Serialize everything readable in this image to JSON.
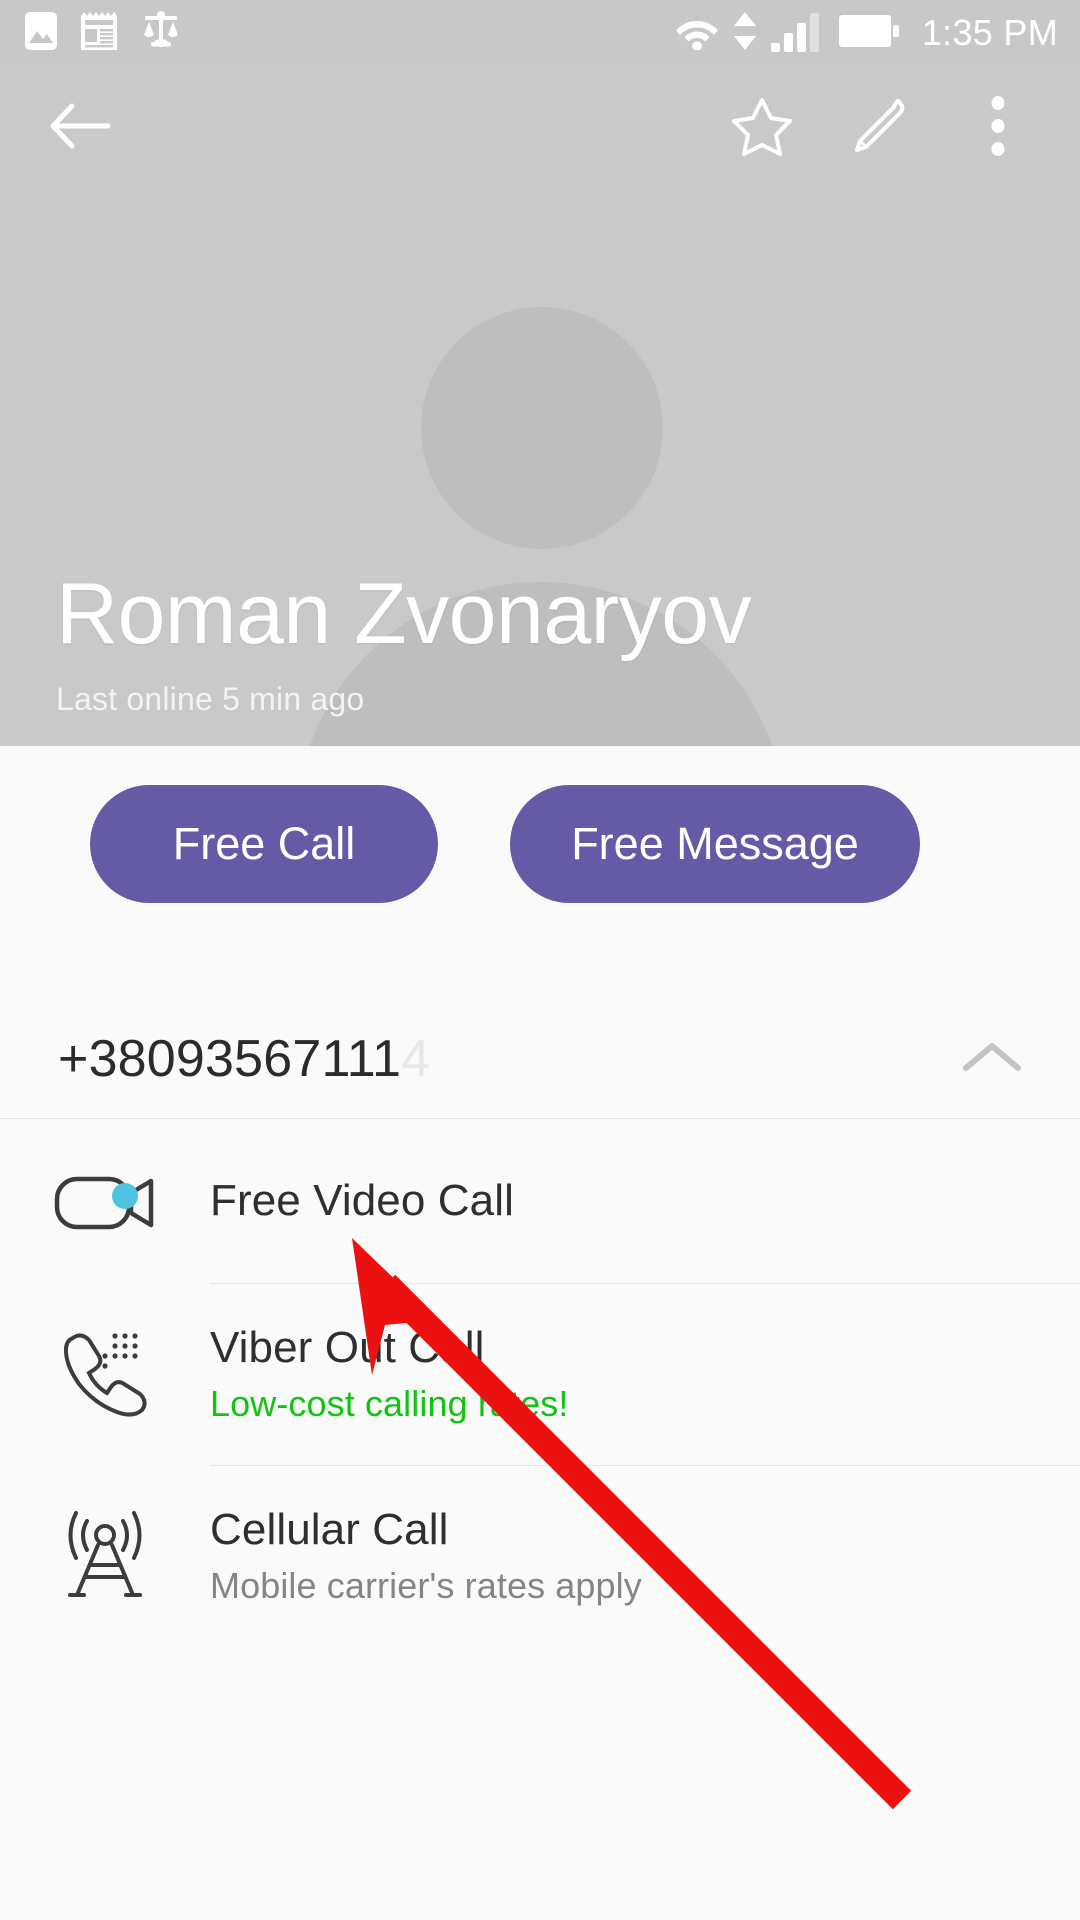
{
  "status_bar": {
    "time": "1:35 PM",
    "left_icons": [
      "image-icon",
      "news-icon",
      "scale-icon"
    ],
    "right_icons": [
      "wifi-icon",
      "data-transfer-icon",
      "signal-icon",
      "battery-icon"
    ]
  },
  "app_bar": {
    "back_icon": "back-arrow-icon",
    "favorite_icon": "star-icon",
    "edit_icon": "pencil-icon",
    "overflow_icon": "more-vertical-icon"
  },
  "hero": {
    "contact_name": "Roman Zvonaryov",
    "presence": "Last online 5 min ago",
    "avatar_placeholder": "person-avatar-placeholder",
    "background_color": "#c9c9c9"
  },
  "actions": {
    "free_call_label": "Free Call",
    "free_message_label": "Free Message",
    "accent_color": "#655aa6"
  },
  "phone": {
    "number": "+38093567111",
    "number_trailing": "4",
    "collapse_icon": "chevron-up-icon"
  },
  "call_options": [
    {
      "title": "Free Video Call",
      "subtitle": "",
      "subtitle_color": "",
      "icon": "video-camera-icon",
      "badge": "new-feature-dot",
      "badge_color": "#4ec3e0"
    },
    {
      "title": "Viber Out Call",
      "subtitle": "Low-cost calling rates!",
      "subtitle_color": "#12c412",
      "icon": "phone-keypad-icon",
      "badge": "",
      "badge_color": ""
    },
    {
      "title": "Cellular Call",
      "subtitle": "Mobile carrier's rates apply",
      "subtitle_color": "#858585",
      "icon": "cell-tower-icon",
      "badge": "",
      "badge_color": ""
    }
  ],
  "annotation": {
    "type": "red-arrow",
    "color": "#ec1111",
    "points_to": "Free Video Call"
  }
}
